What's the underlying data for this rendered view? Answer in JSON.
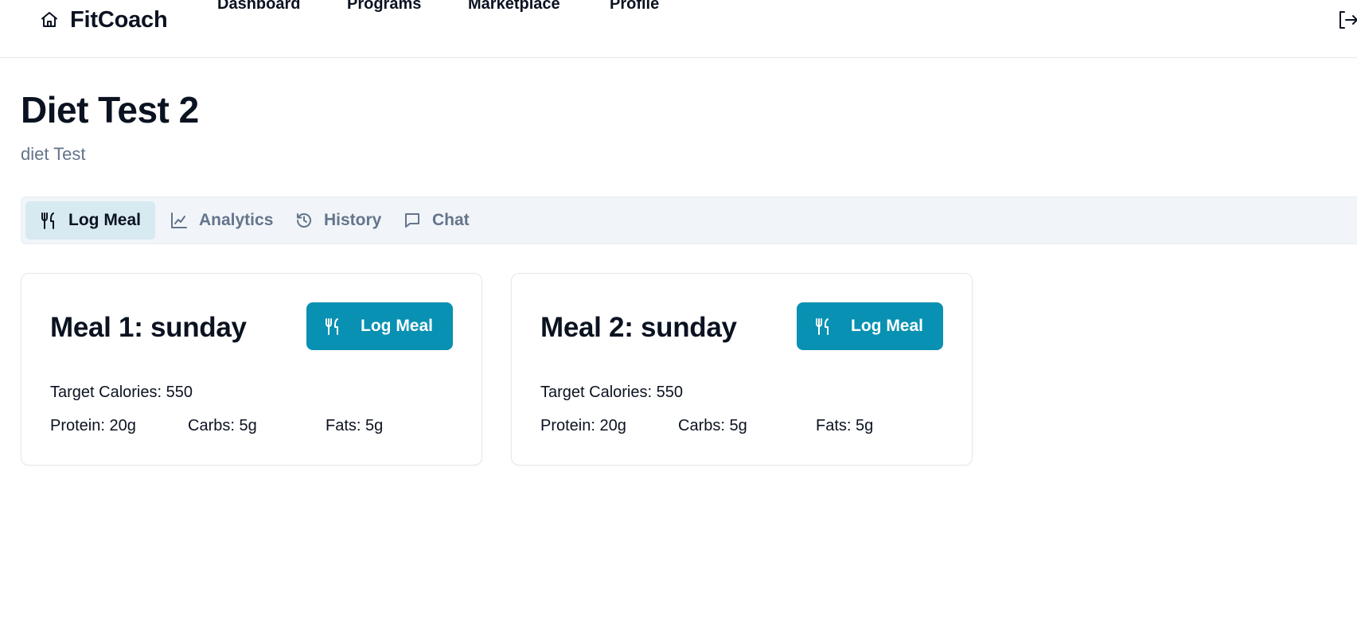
{
  "app": {
    "brand": "FitCoach",
    "brand_icon": "home-icon",
    "accent_color": "#0891b2"
  },
  "nav": {
    "items": [
      {
        "label": "Dashboard"
      },
      {
        "label": "Programs"
      },
      {
        "label": "Marketplace"
      },
      {
        "label": "Profile"
      }
    ],
    "logout_icon": "logout-icon"
  },
  "page": {
    "title": "Diet Test 2",
    "subtitle": "diet Test"
  },
  "tabs": [
    {
      "label": "Log Meal",
      "icon": "utensils-icon",
      "active": true
    },
    {
      "label": "Analytics",
      "icon": "line-chart-icon",
      "active": false
    },
    {
      "label": "History",
      "icon": "history-icon",
      "active": false
    },
    {
      "label": "Chat",
      "icon": "chat-icon",
      "active": false
    }
  ],
  "meals": [
    {
      "title": "Meal 1: sunday",
      "button_label": "Log Meal",
      "target_calories": "Target Calories: 550",
      "protein": "Protein: 20g",
      "carbs": "Carbs: 5g",
      "fats": "Fats: 5g"
    },
    {
      "title": "Meal 2: sunday",
      "button_label": "Log Meal",
      "target_calories": "Target Calories: 550",
      "protein": "Protein: 20g",
      "carbs": "Carbs: 5g",
      "fats": "Fats: 5g"
    }
  ]
}
